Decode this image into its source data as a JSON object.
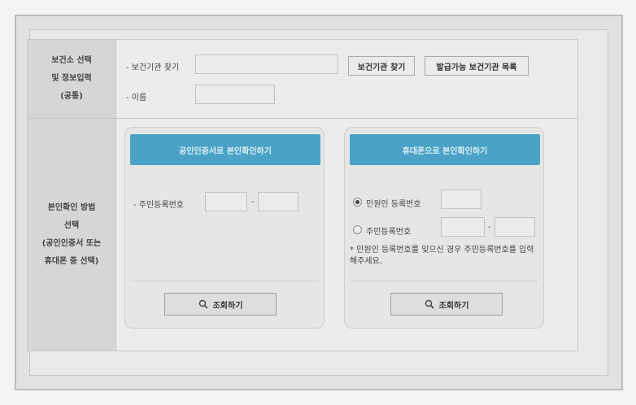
{
  "common": {
    "section_label": [
      "보건소 선택",
      "및 정보입력",
      "(공통)"
    ],
    "find_org_label": "- 보건기관 찾기",
    "find_org_button": "보건기관 찾기",
    "org_list_button": "발급가능 보건기관 목록",
    "name_label": "- 이름"
  },
  "verify": {
    "section_label": [
      "본인확인 방법",
      "선택",
      "(공인인증서 또는",
      "휴대폰 중 선택)"
    ],
    "cert_panel": {
      "title": "공인인증서로 본인확인하기",
      "rrn_label": "- 주민등록번호",
      "dash": "-",
      "search_label": "조회하기"
    },
    "phone_panel": {
      "title": "휴대폰으로 본인확인하기",
      "applicant_reg_label": "민원인 등록번호",
      "rrn_label": "주민등록번호",
      "dash": "-",
      "note": "* 민원인 등록번호를 잊으신 경우 주민등록번호를 입력해주세요.",
      "search_label": "조회하기"
    }
  },
  "icons": {
    "search": "magnifier-icon"
  }
}
